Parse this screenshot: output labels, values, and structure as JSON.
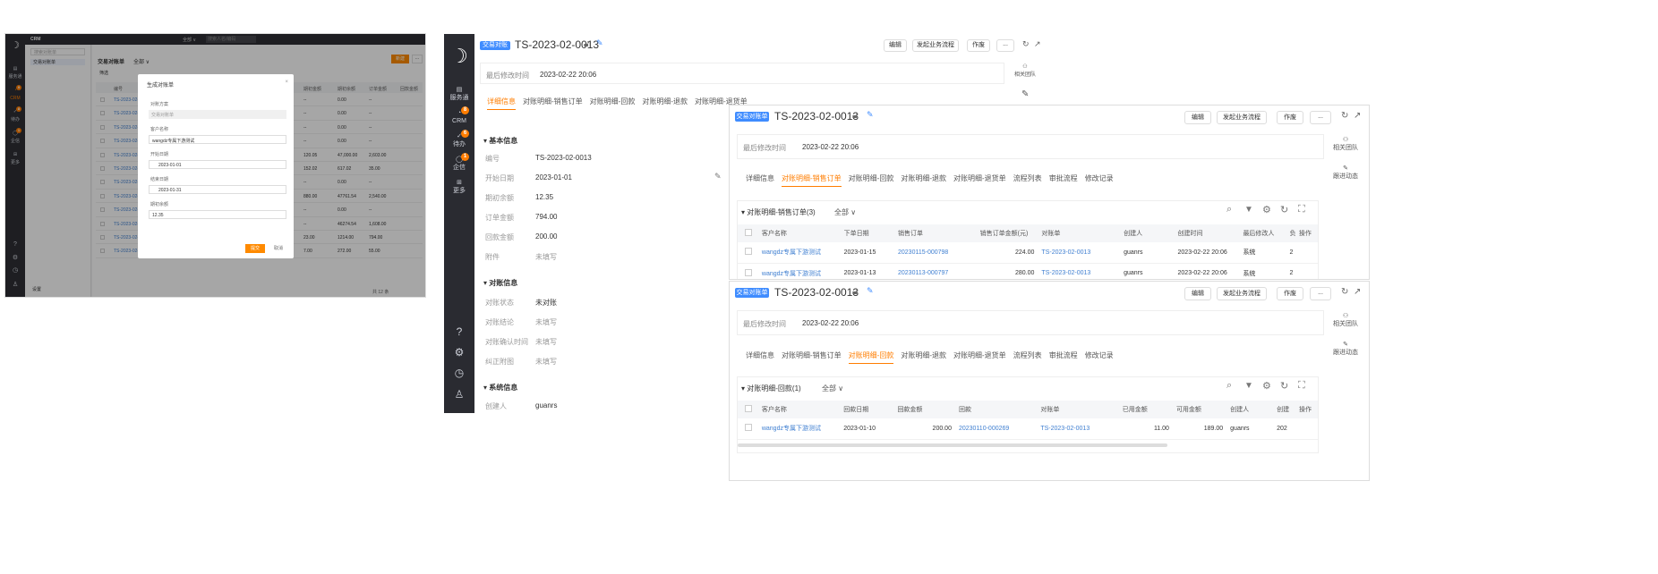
{
  "shot1": {
    "app": "CRM",
    "search_placeholder": "搜索对账单",
    "top_filter": "全部 ∨",
    "top_search": "搜索人名/编码",
    "sidebar": [
      "服务通",
      "CRM",
      "待办",
      "企信",
      "更多"
    ],
    "sidebar_badges": [
      "9",
      "8",
      "1"
    ],
    "left_nav": "交易对账单",
    "settings": "设置",
    "header": "交易对账单",
    "scope": "全部 ∨",
    "new_btn": "新建",
    "more": "···",
    "filter": "筛选",
    "col_code": "编号",
    "columns": [
      "期初金额",
      "期初余额",
      "订单金额",
      "回款金额"
    ],
    "rows": [
      {
        "code": "TS-2023-02-001",
        "v": [
          "--",
          "0.00",
          "--"
        ]
      },
      {
        "code": "TS-2023-02-001",
        "v": [
          "--",
          "0.00",
          "--"
        ]
      },
      {
        "code": "TS-2023-02-001",
        "v": [
          "--",
          "0.00",
          "--"
        ]
      },
      {
        "code": "TS-2023-02-001",
        "v": [
          "--",
          "0.00",
          "--"
        ]
      },
      {
        "code": "TS-2023-02-000",
        "v": [
          "120.05",
          "47,000.00",
          "2,603.00"
        ]
      },
      {
        "code": "TS-2023-02-000",
        "v": [
          "152.02",
          "617.02",
          "35.00"
        ]
      },
      {
        "code": "TS-2023-02-000",
        "v": [
          "--",
          "0.00",
          "--"
        ]
      },
      {
        "code": "TS-2023-02-000",
        "v": [
          "880.00",
          "47761.54",
          "2,540.00"
        ]
      },
      {
        "code": "TS-2023-02-000",
        "v": [
          "--",
          "0.00",
          "--"
        ]
      },
      {
        "code": "TS-2023-02-000",
        "v": [
          "--",
          "46274.54",
          "1,608.00"
        ]
      },
      {
        "code": "TS-2023-02-000",
        "v": [
          "23.00",
          "1214.00",
          "794.00"
        ]
      },
      {
        "code": "TS-2023-02-000",
        "v": [
          "7.00",
          "272.00",
          "55.00"
        ]
      }
    ],
    "footer": "共 12 条",
    "dialog": {
      "title": "生成对账单",
      "f1": "对账方案",
      "f1_ph": "交易对账单",
      "f2": "客户名称",
      "f2_v": "wangdz专属下游测试",
      "f3": "开始日期",
      "f3_v": "2023-01-01",
      "f4": "结束日期",
      "f4_v": "2023-01-31",
      "f5": "期初余额",
      "f5_v": "12.35",
      "ok": "提交",
      "cancel": "取消"
    }
  },
  "detail": {
    "tag": "交易对账单",
    "title": "TS-2023-02-0013",
    "btn_edit": "编辑",
    "btn_flow": "发起业务流程",
    "btn_void": "作废",
    "btn_more": "...",
    "mod_label": "最后修改时间",
    "mod_value": "2023-02-22 20:06",
    "related_team": "相关团队",
    "follow": "跟进动态",
    "tabs": [
      "详细信息",
      "对账明细-销售订单",
      "对账明细-回款",
      "对账明细-退款",
      "对账明细-退货单",
      "流程列表",
      "审批流程",
      "修改记录"
    ],
    "sec_basic": "基本信息",
    "basic": [
      {
        "l": "编号",
        "v": "TS-2023-02-0013"
      },
      {
        "l": "开始日期",
        "v": "2023-01-01"
      },
      {
        "l": "期初余额",
        "v": "12.35"
      },
      {
        "l": "订单金额",
        "v": "794.00"
      },
      {
        "l": "回款金额",
        "v": "200.00"
      },
      {
        "l": "附件",
        "v": "未填写"
      }
    ],
    "sec_recon": "对账信息",
    "recon": [
      {
        "l": "对账状态",
        "v": "未对账"
      },
      {
        "l": "对账结论",
        "v": "未填写"
      },
      {
        "l": "对账确认时间",
        "v": "未填写"
      },
      {
        "l": "纠正附图",
        "v": "未填写"
      }
    ],
    "sec_sys": "系统信息",
    "creator_l": "创建人",
    "creator_v": "guanrs",
    "sidebar": [
      "服务通",
      "CRM",
      "待办",
      "企信",
      "更多"
    ],
    "badges": [
      "8",
      "6",
      "1"
    ]
  },
  "orders": {
    "title": "对账明细-销售订单(3)",
    "scope": "全部 ∨",
    "cols": [
      "客户名称",
      "下单日期",
      "销售订单",
      "销售订单金额(元)",
      "对账单",
      "创建人",
      "创建时间",
      "最后修改人",
      "负",
      "操作"
    ],
    "rows": [
      [
        "wangdz专属下游测试",
        "2023-01-15",
        "20230115-000798",
        "224.00",
        "TS-2023-02-0013",
        "guanrs",
        "2023-02-22 20:06",
        "系统",
        "2"
      ],
      [
        "wangdz专属下游测试",
        "2023-01-13",
        "20230113-000797",
        "280.00",
        "TS-2023-02-0013",
        "guanrs",
        "2023-02-22 20:06",
        "系统",
        "2"
      ]
    ]
  },
  "payments": {
    "title": "对账明细-回款(1)",
    "scope": "全部 ∨",
    "cols": [
      "客户名称",
      "回款日期",
      "回款金额",
      "回款",
      "对账单",
      "已用金额",
      "可用金额",
      "创建人",
      "创建",
      "操作"
    ],
    "rows": [
      [
        "wangdz专属下游测试",
        "2023-01-10",
        "200.00",
        "20230110-000269",
        "TS-2023-02-0013",
        "11.00",
        "189.00",
        "guanrs",
        "202"
      ]
    ]
  }
}
